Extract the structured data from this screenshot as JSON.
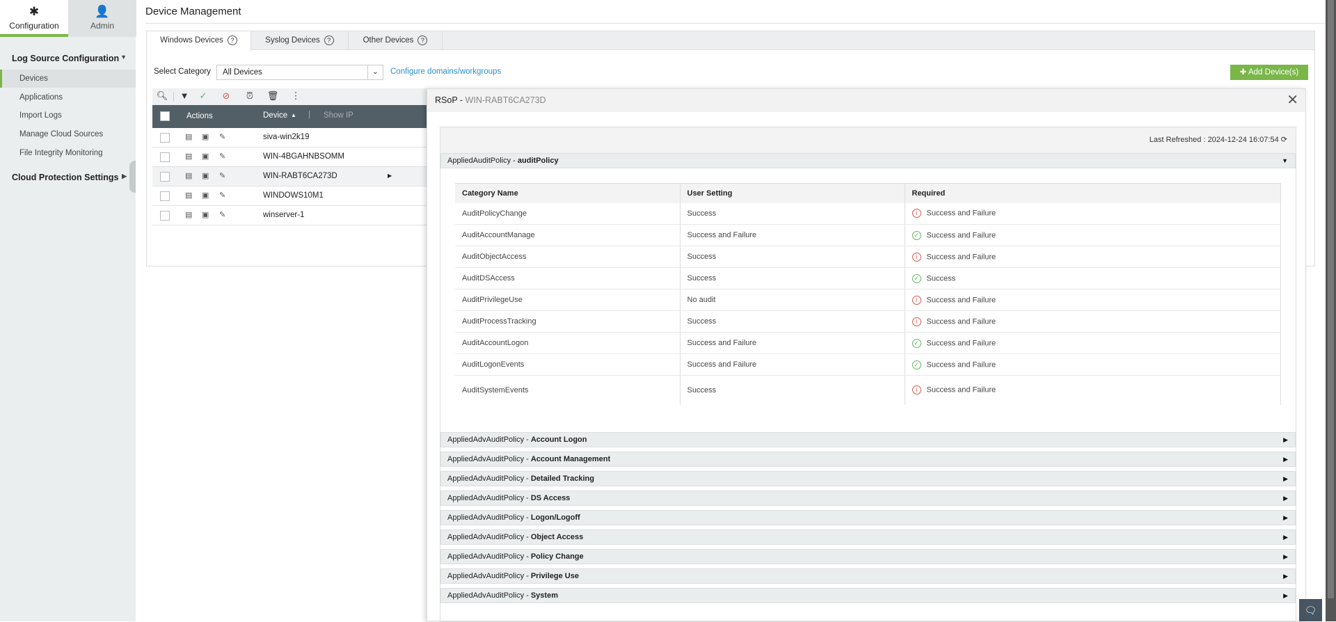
{
  "sidebar": {
    "tabs": [
      {
        "label": "Configuration",
        "icon": "gear-icon"
      },
      {
        "label": "Admin",
        "icon": "user-icon"
      }
    ],
    "groups": [
      {
        "label": "Log Source Configuration"
      },
      {
        "label": "Cloud Protection Settings"
      }
    ],
    "items": [
      {
        "label": "Devices"
      },
      {
        "label": "Applications"
      },
      {
        "label": "Import Logs"
      },
      {
        "label": "Manage Cloud Sources"
      },
      {
        "label": "File Integrity Monitoring"
      }
    ]
  },
  "main": {
    "title": "Device Management",
    "tabs": [
      {
        "label": "Windows Devices"
      },
      {
        "label": "Syslog Devices"
      },
      {
        "label": "Other Devices"
      }
    ],
    "category_label": "Select Category",
    "category_value": "All Devices",
    "configure_link": "Configure domains/workgroups",
    "add_button": "Add Device(s)",
    "table": {
      "headers": {
        "actions": "Actions",
        "device": "Device",
        "show_ip": "Show IP"
      },
      "rows": [
        {
          "device": "siva-win2k19"
        },
        {
          "device": "WIN-4BGAHNBSOMM"
        },
        {
          "device": "WIN-RABT6CA273D"
        },
        {
          "device": "WINDOWS10M1"
        },
        {
          "device": "winserver-1"
        }
      ]
    }
  },
  "modal": {
    "title": "RSoP",
    "separator": " - ",
    "device": "WIN-RABT6CA273D",
    "last_refreshed": "Last Refreshed : 2024-12-24 16:07:54",
    "open_section": {
      "prefix": "AppliedAuditPolicy - ",
      "name": "auditPolicy"
    },
    "columns": [
      "Category Name",
      "User Setting",
      "Required"
    ],
    "rows": [
      {
        "category": "AuditPolicyChange",
        "setting": "Success",
        "required": "Success and Failure",
        "status": "warn"
      },
      {
        "category": "AuditAccountManage",
        "setting": "Success and Failure",
        "required": "Success and Failure",
        "status": "ok"
      },
      {
        "category": "AuditObjectAccess",
        "setting": "Success",
        "required": "Success and Failure",
        "status": "warn"
      },
      {
        "category": "AuditDSAccess",
        "setting": "Success",
        "required": "Success",
        "status": "ok"
      },
      {
        "category": "AuditPrivilegeUse",
        "setting": "No audit",
        "required": "Success and Failure",
        "status": "warn"
      },
      {
        "category": "AuditProcessTracking",
        "setting": "Success",
        "required": "Success and Failure",
        "status": "warn"
      },
      {
        "category": "AuditAccountLogon",
        "setting": "Success and Failure",
        "required": "Success and Failure",
        "status": "ok"
      },
      {
        "category": "AuditLogonEvents",
        "setting": "Success and Failure",
        "required": "Success and Failure",
        "status": "ok"
      },
      {
        "category": "AuditSystemEvents",
        "setting": "Success",
        "required": "Success and Failure",
        "status": "warn"
      }
    ],
    "collapsed_prefix": "AppliedAdvAuditPolicy - ",
    "collapsed_sections": [
      "Account Logon",
      "Account Management",
      "Detailed Tracking",
      "DS Access",
      "Logon/Logoff",
      "Object Access",
      "Policy Change",
      "Privilege Use",
      "System"
    ]
  },
  "colors": {
    "accent": "#7ab648",
    "header": "#525f66",
    "link": "#2a8fd0",
    "warn": "#d9534f",
    "ok": "#5cb85c"
  }
}
